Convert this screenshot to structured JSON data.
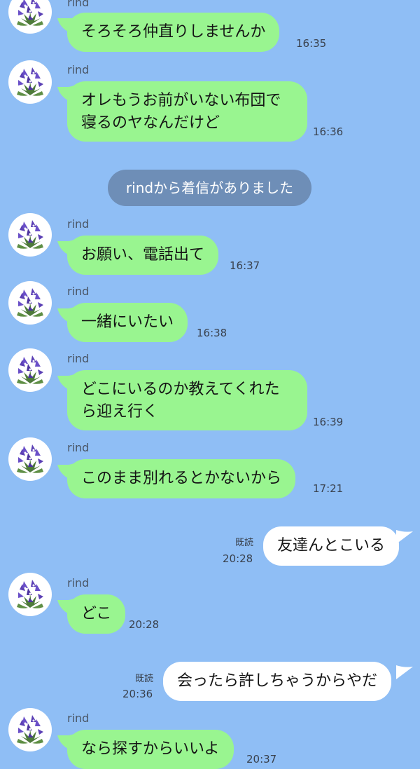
{
  "sender_name": "rind",
  "system_notice": "rindから着信がありました",
  "read_label": "既読",
  "avatar_icon": "gentian-flower-icon",
  "colors": {
    "background": "#8fbef5",
    "incoming_bubble": "#99f590",
    "outgoing_bubble": "#ffffff",
    "system_pill": "#6e8eb7"
  },
  "messages": [
    {
      "direction": "incoming",
      "text": "そろそろ仲直りしませんか",
      "time": "16:35"
    },
    {
      "direction": "incoming",
      "text": "オレもうお前がいない布団で\n寝るのヤなんだけど",
      "time": "16:36"
    },
    {
      "direction": "incoming",
      "text": "お願い、電話出て",
      "time": "16:37"
    },
    {
      "direction": "incoming",
      "text": "一緒にいたい",
      "time": "16:38"
    },
    {
      "direction": "incoming",
      "text": "どこにいるのか教えてくれた\nら迎え行く",
      "time": "16:39"
    },
    {
      "direction": "incoming",
      "text": "このまま別れるとかないから",
      "time": "17:21"
    },
    {
      "direction": "outgoing",
      "text": "友達んとこいる",
      "time": "20:28",
      "read": "既読"
    },
    {
      "direction": "incoming",
      "text": "どこ",
      "time": "20:28"
    },
    {
      "direction": "outgoing",
      "text": "会ったら許しちゃうからやだ",
      "time": "20:36",
      "read": "既読"
    },
    {
      "direction": "incoming",
      "text": "なら探すからいいよ",
      "time": "20:37"
    }
  ]
}
